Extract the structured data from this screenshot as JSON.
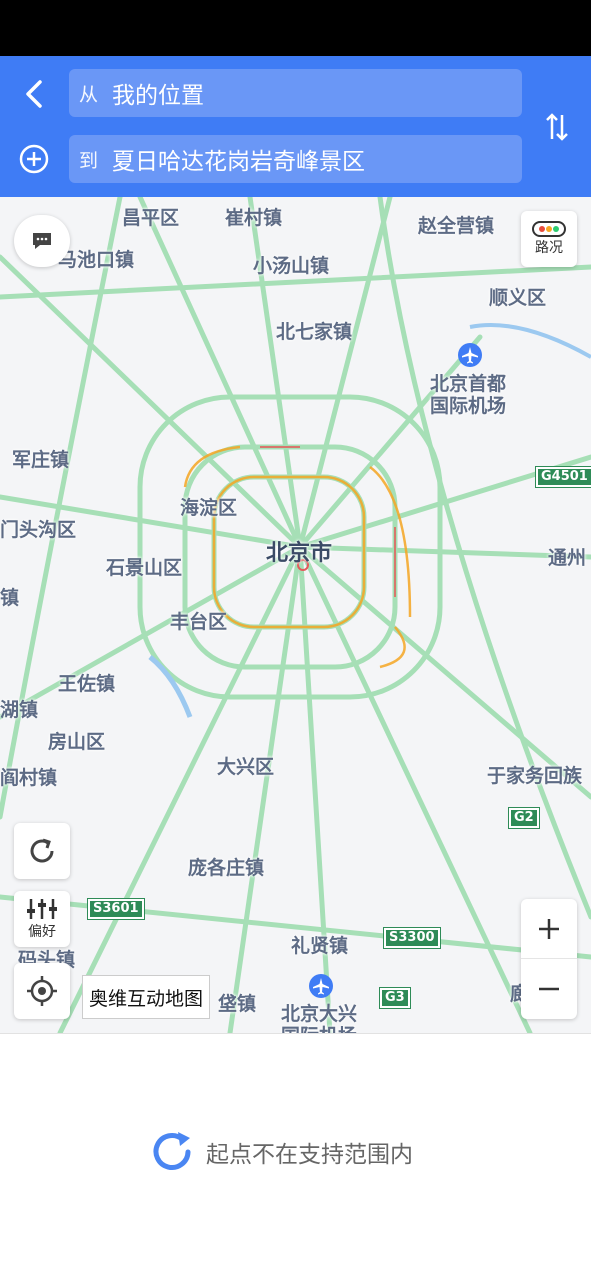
{
  "route": {
    "from_prefix": "从",
    "from_value": "我的位置",
    "to_prefix": "到",
    "to_value": "夏日哈达花岗岩奇峰景区"
  },
  "map": {
    "traffic_label": "路况",
    "preference_label": "偏好",
    "brand_label": "奥维互动地图",
    "labels": {
      "changping": "昌平区",
      "cuicun": "崔村镇",
      "zhaoquanying": "赵全营镇",
      "machikou": "马池口镇",
      "xiaotangshan": "小汤山镇",
      "shunyi": "顺义区",
      "beiqijia": "北七家镇",
      "airport": "北京首都\n国际机场",
      "junzhuang": "军庄镇",
      "haidian": "海淀区",
      "mentougou": "门头沟区",
      "beijing": "北京市",
      "tongzhou": "通州",
      "shijingshan": "石景山区",
      "zhen_left": "镇",
      "fengtai": "丰台区",
      "wangzuo": "王佐镇",
      "hu": "湖镇",
      "fangshan": "房山区",
      "yancun": "阎村镇",
      "daxing": "大兴区",
      "yujiawu": "于家务回族",
      "panggezhuang": "庞各庄镇",
      "lixian": "礼贤镇",
      "zhuotou": "码头镇",
      "zhuangzhen": "垡镇",
      "daxing_airport": "北京大兴\n国际机场",
      "langfang": "廊坊市"
    },
    "shields": {
      "g4501": "G4501",
      "g2": "G2",
      "s3601": "S3601",
      "s3300": "S3300",
      "g3": "G3"
    }
  },
  "status": {
    "message": "起点不在支持范围内"
  },
  "colors": {
    "header": "#3f7cf5",
    "road": "#a6dfb6",
    "congestion": "#f5a623"
  }
}
